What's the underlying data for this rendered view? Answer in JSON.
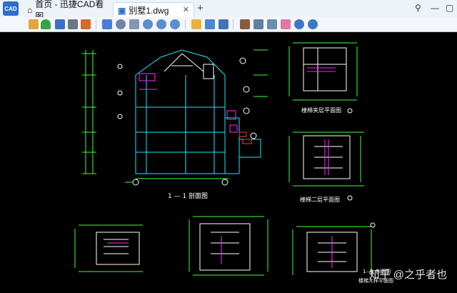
{
  "tabs": [
    {
      "label": "首页 - 迅捷CAD看图",
      "icon": "home-icon"
    },
    {
      "label": "别墅1.dwg",
      "icon": "cad-file-icon"
    }
  ],
  "app_logo_text": "CAD",
  "window_controls": [
    "pin-icon",
    "minimize-icon",
    "maximize-icon"
  ],
  "toolbar_icons": [
    "open-icon",
    "tree-icon",
    "save-icon",
    "print-icon",
    "print-preview-icon",
    "pan-icon",
    "zoom-window-icon",
    "zoom-extent-icon",
    "zoom-in-icon",
    "zoom-out-icon",
    "zoom-previous-icon",
    "layers-icon",
    "3d-box-icon",
    "3d-view-icon",
    "line-icon",
    "rect-icon",
    "measure-icon",
    "eraser-icon",
    "undo-icon",
    "redo-icon"
  ],
  "drawing": {
    "section_title": "1 — 1 剖面图",
    "plan_titles": [
      "楼梯夹层平面图",
      "楼梯二层平面图",
      "1—1 剖面图",
      "楼梯大样平面图"
    ]
  },
  "watermark": "知乎 @之乎者也",
  "colors": {
    "background": "#000000",
    "green": "#3bff3b",
    "cyan": "#17e7ff",
    "magenta": "#ff2aff",
    "yellow": "#f5f31a",
    "white": "#ffffff",
    "red": "#ff3b3b"
  }
}
